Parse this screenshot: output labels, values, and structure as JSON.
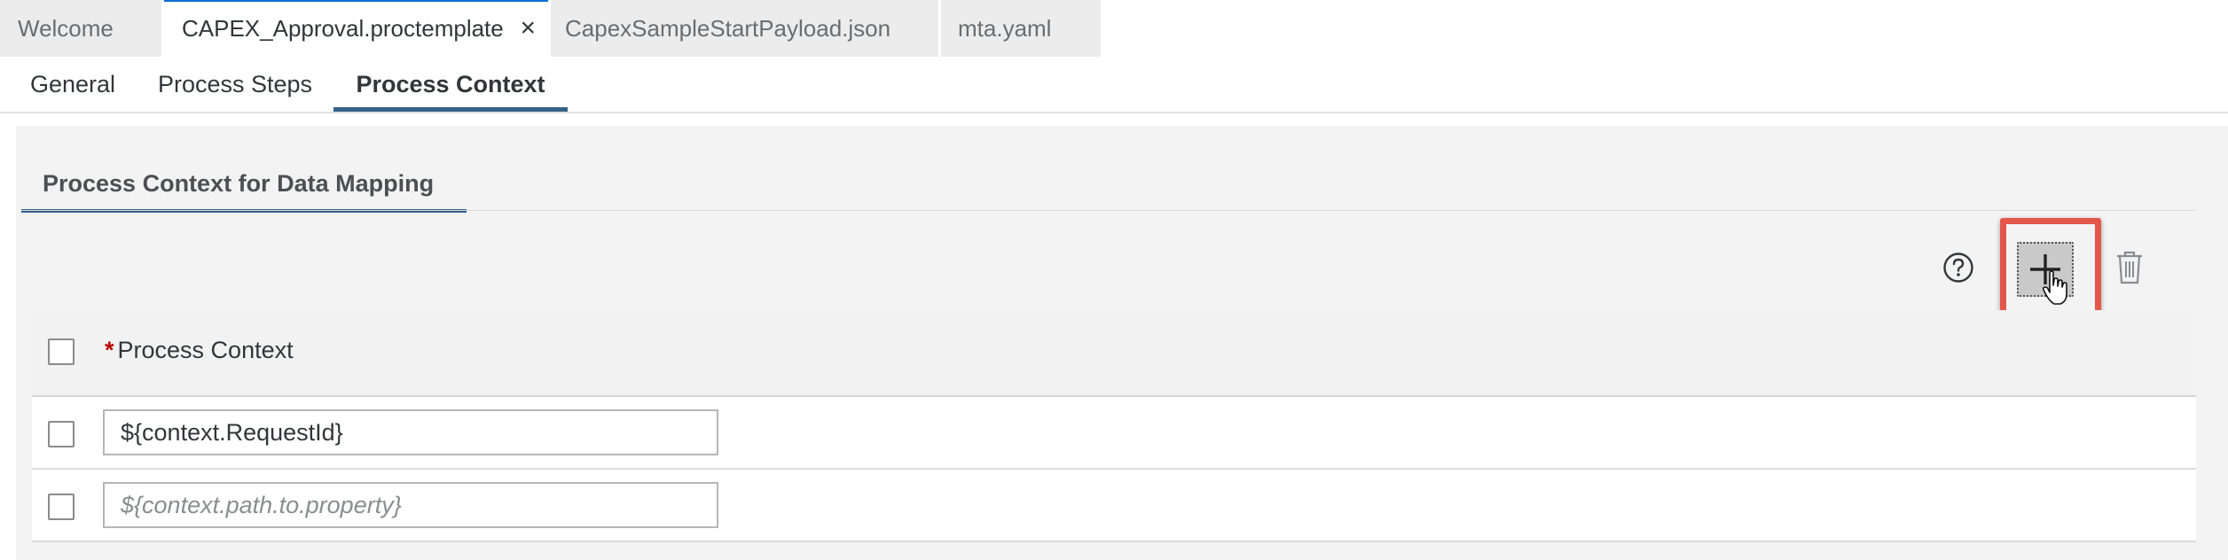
{
  "editor_tabs": [
    {
      "label": "Welcome",
      "active": false
    },
    {
      "label": "CAPEX_Approval.proctemplate",
      "active": true,
      "close": "×"
    },
    {
      "label": "CapexSampleStartPayload.json",
      "active": false
    },
    {
      "label": "mta.yaml",
      "active": false
    }
  ],
  "sub_tabs": [
    {
      "label": "General"
    },
    {
      "label": "Process Steps"
    },
    {
      "label": "Process Context",
      "active": true
    }
  ],
  "section": {
    "title": "Process Context for Data Mapping"
  },
  "toolbar": {
    "help_icon": "question-circle-icon",
    "add_icon": "plus-icon",
    "delete_icon": "trash-icon",
    "highlight_color": "#e3574a"
  },
  "table": {
    "header": {
      "required_marker": "*",
      "label": "Process Context"
    },
    "rows": [
      {
        "value": "${context.RequestId}",
        "placeholder": ""
      },
      {
        "value": "",
        "placeholder": "${context.path.to.property}"
      }
    ]
  },
  "colors": {
    "accent": "#346187",
    "required": "#bb0000"
  }
}
